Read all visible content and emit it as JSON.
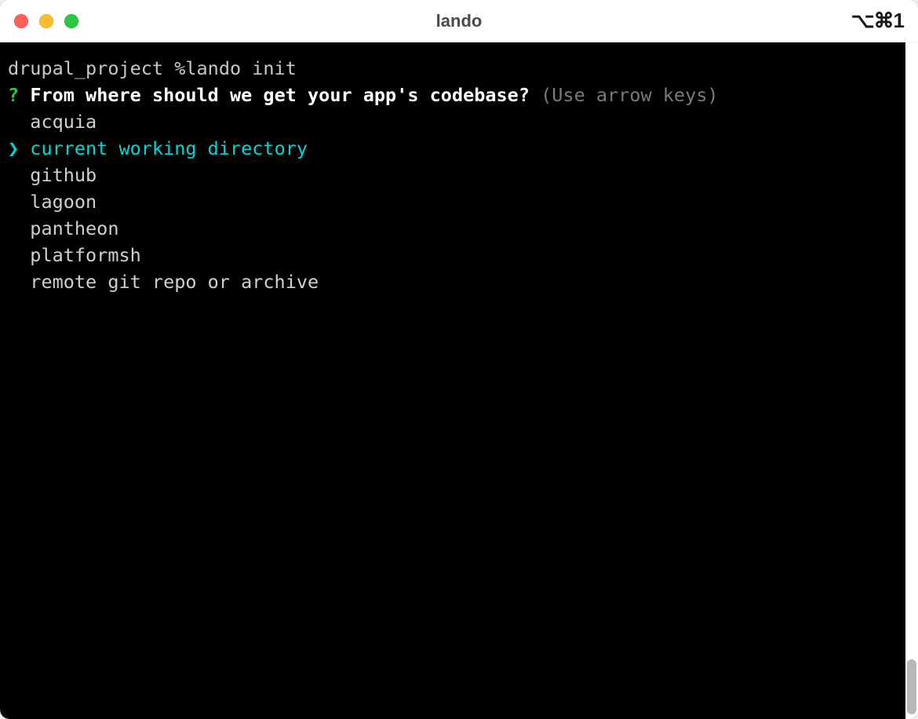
{
  "window": {
    "title": "lando",
    "shortcut_label": "⌥⌘1"
  },
  "terminal": {
    "prompt": "drupal_project %",
    "command": "lando init",
    "question_marker": "?",
    "question": "From where should we get your app's codebase?",
    "hint": "(Use arrow keys)",
    "pointer": "❯",
    "selected_index": 1,
    "options": [
      "acquia",
      "current working directory",
      "github",
      "lagoon",
      "pantheon",
      "platformsh",
      "remote git repo or archive"
    ]
  }
}
